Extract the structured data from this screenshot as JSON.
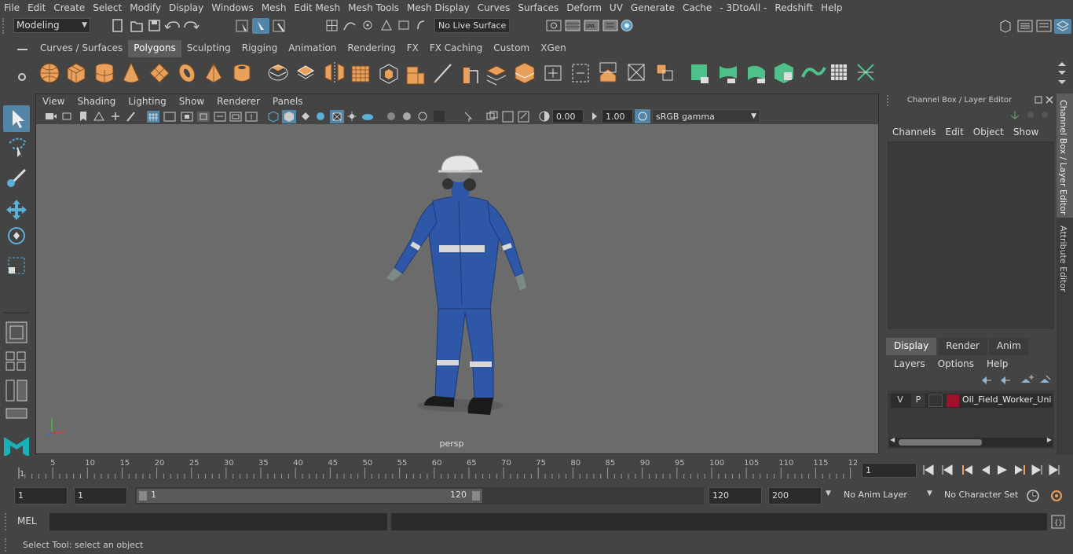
{
  "menubar": {
    "items": [
      "File",
      "Edit",
      "Create",
      "Select",
      "Modify",
      "Display",
      "Windows",
      "Mesh",
      "Edit Mesh",
      "Mesh Tools",
      "Mesh Display",
      "Curves",
      "Surfaces",
      "Deform",
      "UV",
      "Generate",
      "Cache",
      "- 3DtoAll -",
      "Redshift",
      "Help"
    ]
  },
  "statusline": {
    "mode": "Modeling",
    "live_surface": "No Live Surface"
  },
  "shelf": {
    "tabs": [
      "Curves / Surfaces",
      "Polygons",
      "Sculpting",
      "Rigging",
      "Animation",
      "Rendering",
      "FX",
      "FX Caching",
      "Custom",
      "XGen"
    ],
    "active_tab": "Polygons"
  },
  "viewport": {
    "menu": [
      "View",
      "Shading",
      "Lighting",
      "Show",
      "Renderer",
      "Panels"
    ],
    "exposure": "0.00",
    "gamma": "1.00",
    "color_space": "sRGB gamma",
    "camera_label": "persp"
  },
  "channelbox": {
    "title": "Channel Box / Layer Editor",
    "menu": [
      "Channels",
      "Edit",
      "Object",
      "Show"
    ],
    "tabs": [
      "Display",
      "Render",
      "Anim"
    ],
    "active_tab": "Display",
    "layer_menu": [
      "Layers",
      "Options",
      "Help"
    ],
    "layer": {
      "v": "V",
      "p": "P",
      "name": "Oil_Field_Worker_Unif",
      "color": "#a0102a"
    }
  },
  "side_tabs": [
    "Channel Box / Layer Editor",
    "Attribute Editor"
  ],
  "timeline": {
    "ticks": [
      "5",
      "10",
      "15",
      "20",
      "25",
      "30",
      "35",
      "40",
      "45",
      "50",
      "55",
      "60",
      "65",
      "70",
      "75",
      "80",
      "85",
      "90",
      "95",
      "100",
      "105",
      "110",
      "115",
      "12"
    ],
    "start_label": "1",
    "current_frame": "1"
  },
  "range": {
    "start": "1",
    "playback_start": "1",
    "slider_start": "1",
    "slider_end": "120",
    "playback_end": "120",
    "end": "200",
    "anim_layer": "No Anim Layer",
    "character_set": "No Character Set"
  },
  "mel": {
    "label": "MEL"
  },
  "help_line": "Select Tool: select an object",
  "colors": {
    "accent": "#5285a6",
    "shelf_icon": "#e8a05a",
    "shelf_icon_green": "#4ec08a",
    "suit_blue": "#2e57a8"
  }
}
